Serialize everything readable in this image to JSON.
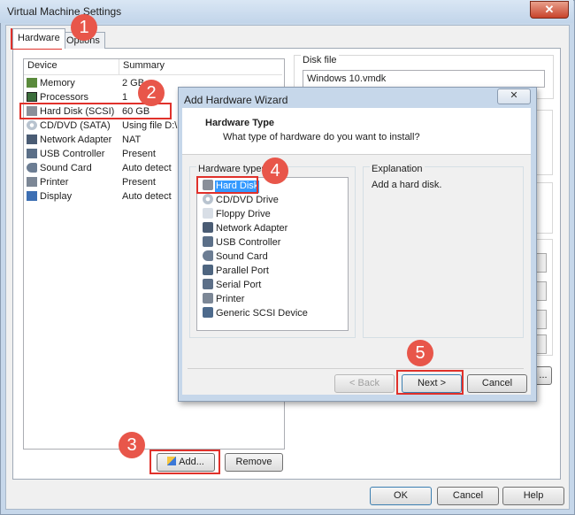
{
  "window": {
    "title": "Virtual Machine Settings",
    "close_label": "✕"
  },
  "tabs": [
    {
      "label": "Hardware"
    },
    {
      "label": "Options"
    }
  ],
  "devices": {
    "header": {
      "device": "Device",
      "summary": "Summary"
    },
    "rows": [
      {
        "name": "Memory",
        "summary": "2 GB"
      },
      {
        "name": "Processors",
        "summary": "1"
      },
      {
        "name": "Hard Disk (SCSI)",
        "summary": "60 GB"
      },
      {
        "name": "CD/DVD (SATA)",
        "summary": "Using file D:\\P"
      },
      {
        "name": "Network Adapter",
        "summary": "NAT"
      },
      {
        "name": "USB Controller",
        "summary": "Present"
      },
      {
        "name": "Sound Card",
        "summary": "Auto detect"
      },
      {
        "name": "Printer",
        "summary": "Present"
      },
      {
        "name": "Display",
        "summary": "Auto detect"
      }
    ]
  },
  "disk": {
    "group_label": "Disk file",
    "file": "Windows 10.vmdk"
  },
  "device_buttons": {
    "add": "Add...",
    "remove": "Remove"
  },
  "dialog_buttons": {
    "ok": "OK",
    "cancel": "Cancel",
    "help": "Help",
    "more": "..."
  },
  "wizard": {
    "title": "Add Hardware Wizard",
    "close_label": "✕",
    "heading": "Hardware Type",
    "subheading": "What type of hardware do you want to install?",
    "types_label": "Hardware types:",
    "types": [
      "Hard Disk",
      "CD/DVD Drive",
      "Floppy Drive",
      "Network Adapter",
      "USB Controller",
      "Sound Card",
      "Parallel Port",
      "Serial Port",
      "Printer",
      "Generic SCSI Device"
    ],
    "explanation_label": "Explanation",
    "explanation": "Add a hard disk.",
    "back": "< Back",
    "next": "Next >",
    "cancel": "Cancel"
  },
  "steps": [
    "1",
    "2",
    "3",
    "4",
    "5"
  ],
  "colors": {
    "highlight": "#e0312b",
    "bubble": "#e8564a",
    "selection": "#3399ff"
  }
}
